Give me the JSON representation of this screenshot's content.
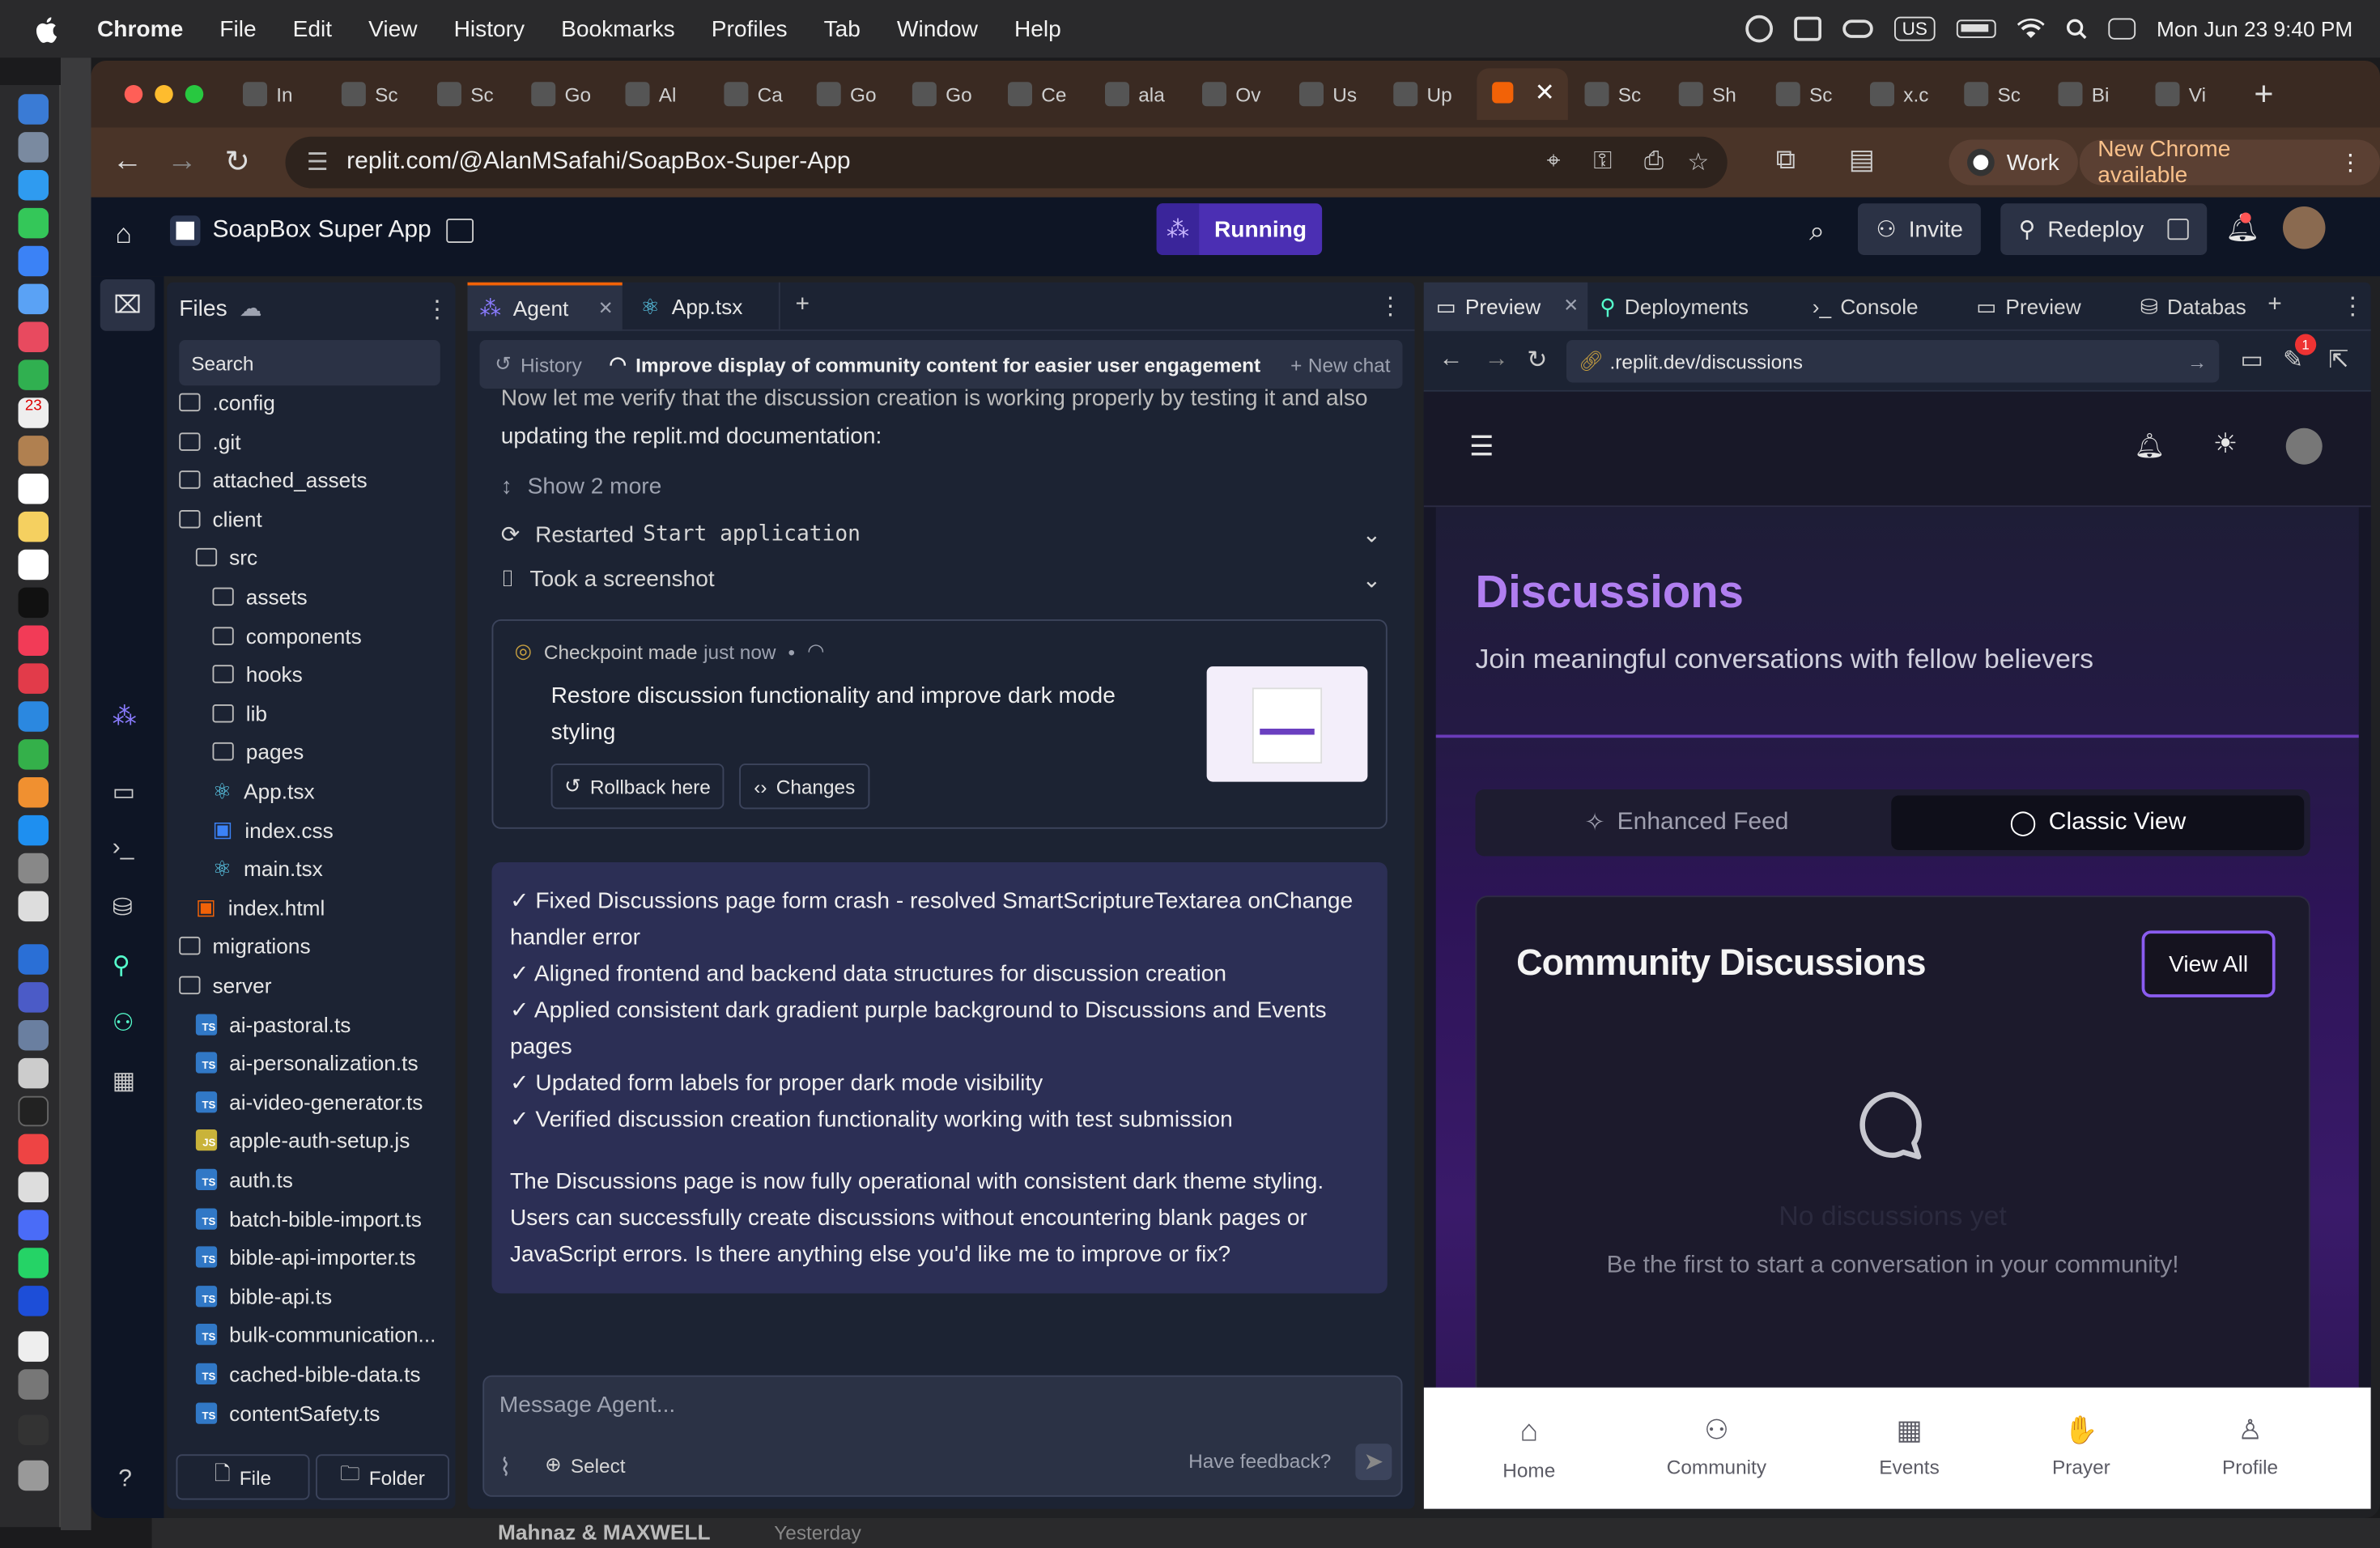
{
  "menubar": {
    "app": "Chrome",
    "items": [
      "File",
      "Edit",
      "View",
      "History",
      "Bookmarks",
      "Profiles",
      "Tab",
      "Window",
      "Help"
    ],
    "clock": "Mon Jun 23  9:40 PM",
    "keyboard": "US"
  },
  "tabs": [
    {
      "icon": "gmail-icon",
      "label": "In"
    },
    {
      "icon": "soapbox-icon",
      "label": "Sc"
    },
    {
      "icon": "docs-icon",
      "label": "Sc"
    },
    {
      "icon": "google-icon",
      "label": "Go"
    },
    {
      "icon": "app-icon",
      "label": "Al"
    },
    {
      "icon": "docs-icon",
      "label": "Ca"
    },
    {
      "icon": "openai-icon",
      "label": "Go"
    },
    {
      "icon": "google-icon",
      "label": "Go"
    },
    {
      "icon": "app-icon",
      "label": "Ce"
    },
    {
      "icon": "github-icon",
      "label": "ala"
    },
    {
      "icon": "car-icon",
      "label": "Ov"
    },
    {
      "icon": "google-icon",
      "label": "Us"
    },
    {
      "icon": "github-icon",
      "label": "Up"
    },
    {
      "icon": "replit-icon",
      "label": ""
    },
    {
      "icon": "soapbox-icon",
      "label": "Sc"
    },
    {
      "icon": "openai-icon",
      "label": "Sh"
    },
    {
      "icon": "soapbox-icon",
      "label": "Sc"
    },
    {
      "icon": "x-icon",
      "label": "x.c"
    },
    {
      "icon": "soapbox-icon",
      "label": "Sc"
    },
    {
      "icon": "app-icon",
      "label": "Bi"
    },
    {
      "icon": "video-icon",
      "label": "Vi"
    }
  ],
  "address": {
    "url": "replit.com/@AlanMSafahi/SoapBox-Super-App",
    "profile": "Work",
    "update": "New Chrome available"
  },
  "replit": {
    "project": "SoapBox Super App",
    "status": "Running",
    "invite": "Invite",
    "redeploy": "Redeploy"
  },
  "files": {
    "title": "Files",
    "search_placeholder": "Search",
    "tree": [
      {
        "name": ".config",
        "kind": "folder",
        "depth": 0
      },
      {
        "name": ".git",
        "kind": "folder",
        "depth": 0
      },
      {
        "name": "attached_assets",
        "kind": "folder",
        "depth": 0
      },
      {
        "name": "client",
        "kind": "folder",
        "depth": 0
      },
      {
        "name": "src",
        "kind": "folder",
        "depth": 1
      },
      {
        "name": "assets",
        "kind": "folder",
        "depth": 2
      },
      {
        "name": "components",
        "kind": "folder",
        "depth": 2
      },
      {
        "name": "hooks",
        "kind": "folder",
        "depth": 2
      },
      {
        "name": "lib",
        "kind": "folder",
        "depth": 2
      },
      {
        "name": "pages",
        "kind": "folder",
        "depth": 2
      },
      {
        "name": "App.tsx",
        "kind": "react",
        "depth": 2
      },
      {
        "name": "index.css",
        "kind": "css",
        "depth": 2
      },
      {
        "name": "main.tsx",
        "kind": "react",
        "depth": 2
      },
      {
        "name": "index.html",
        "kind": "html",
        "depth": 1
      },
      {
        "name": "migrations",
        "kind": "folder",
        "depth": 0
      },
      {
        "name": "server",
        "kind": "folder",
        "depth": 0
      },
      {
        "name": "ai-pastoral.ts",
        "kind": "ts",
        "depth": 1
      },
      {
        "name": "ai-personalization.ts",
        "kind": "ts",
        "depth": 1
      },
      {
        "name": "ai-video-generator.ts",
        "kind": "ts",
        "depth": 1
      },
      {
        "name": "apple-auth-setup.js",
        "kind": "js",
        "depth": 1
      },
      {
        "name": "auth.ts",
        "kind": "ts",
        "depth": 1
      },
      {
        "name": "batch-bible-import.ts",
        "kind": "ts",
        "depth": 1
      },
      {
        "name": "bible-api-importer.ts",
        "kind": "ts",
        "depth": 1
      },
      {
        "name": "bible-api.ts",
        "kind": "ts",
        "depth": 1
      },
      {
        "name": "bulk-communication...",
        "kind": "ts",
        "depth": 1
      },
      {
        "name": "cached-bible-data.ts",
        "kind": "ts",
        "depth": 1
      },
      {
        "name": "contentSafety.ts",
        "kind": "ts",
        "depth": 1
      }
    ],
    "new_file": "File",
    "new_folder": "Folder"
  },
  "agent": {
    "tab_agent": "Agent",
    "tab_file": "App.tsx",
    "history": "History",
    "chat_title": "Improve display of community content for easier user engagement",
    "new_chat": "New chat",
    "intro_cut": "Now let me verify that the discussion creation is working properly by testing it and also",
    "intro": "updating the replit.md documentation:",
    "show_more": "Show 2 more",
    "action1_prefix": "Restarted",
    "action1_code": "Start application",
    "action2": "Took a screenshot",
    "checkpoint_label": "Checkpoint made",
    "checkpoint_time": "just now",
    "checkpoint_title": "Restore discussion functionality and improve dark mode styling",
    "rollback": "Rollback here",
    "changes": "Changes",
    "summary": [
      "✓ Fixed Discussions page form crash - resolved SmartScriptureTextarea onChange handler error",
      "✓ Aligned frontend and backend data structures for discussion creation",
      "✓ Applied consistent dark gradient purple background to Discussions and Events pages",
      "✓ Updated form labels for proper dark mode visibility",
      "✓ Verified discussion creation functionality working with test submission"
    ],
    "closing": "The Discussions page is now fully operational with consistent dark theme styling. Users can successfully create discussions without encountering blank pages or JavaScript errors. Is there anything else you'd like me to improve or fix?",
    "input_placeholder": "Message Agent...",
    "select": "Select",
    "feedback": "Have feedback?"
  },
  "preview": {
    "tabs": [
      "Preview",
      "Deployments",
      "Console",
      "Preview",
      "Databas"
    ],
    "url": ".replit.dev/discussions",
    "notif_count": "1",
    "page_title": "Discussions",
    "page_subtitle": "Join meaningful conversations with fellow believers",
    "toggle_left": "Enhanced Feed",
    "toggle_right": "Classic View",
    "card_title": "Community Discussions",
    "view_all": "View All",
    "empty_title": "No discussions yet",
    "empty_text": "Be the first to start a conversation in your community!",
    "nav": [
      "Home",
      "Community",
      "Events",
      "Prayer",
      "Profile"
    ]
  },
  "behind": {
    "name": "Mahnaz & MAXWELL",
    "when": "Yesterday"
  }
}
